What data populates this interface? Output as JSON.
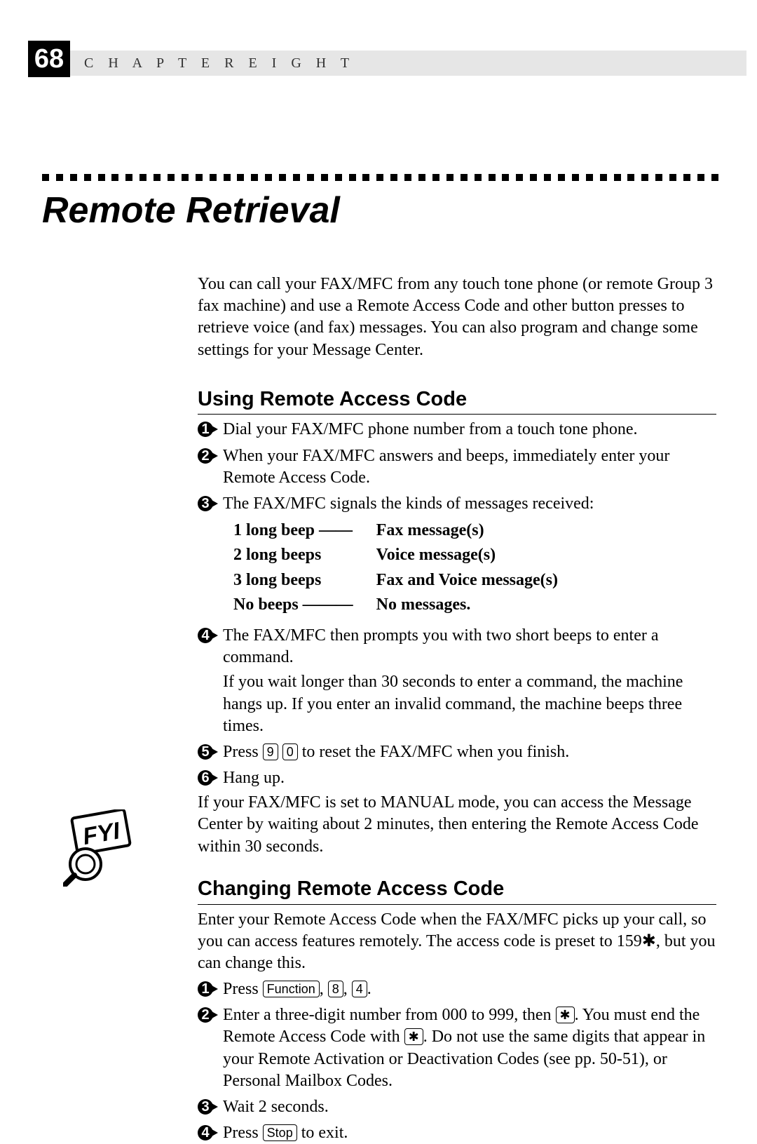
{
  "page": {
    "number": "68",
    "chapterLabel": "C H A P T E R   E I G H T"
  },
  "title": "Remote Retrieval",
  "intro": "You can call your FAX/MFC from any touch tone phone (or remote Group 3 fax machine) and use a Remote Access Code and other button presses to retrieve voice (and fax) messages.  You can also program and change some settings for your Message Center.",
  "section1": {
    "title": "Using Remote Access Code",
    "steps": [
      "Dial your FAX/MFC phone number from a touch tone phone.",
      "When your FAX/MFC answers and beeps, immediately enter your Remote Access Code.",
      "The FAX/MFC signals the kinds of messages received:"
    ],
    "signals": [
      [
        "1 long beep",
        "Fax message(s)"
      ],
      [
        "2 long beeps",
        "Voice message(s)"
      ],
      [
        "3 long beeps",
        "Fax and Voice message(s)"
      ],
      [
        "No beeps",
        "No messages."
      ]
    ],
    "step4a": "The FAX/MFC then prompts you with two short beeps to enter a command.",
    "step4b": "If you wait longer than 30 seconds to enter a command, the machine hangs up.  If you enter an invalid command, the machine beeps three times.",
    "step5_pre": "Press ",
    "step5_k1": "9",
    "step5_k2": "0",
    "step5_post": " to reset the FAX/MFC when you finish.",
    "step6": "Hang up.",
    "note": "If your FAX/MFC is set to MANUAL mode, you can access the Message Center by waiting about 2 minutes, then entering the Remote Access Code within 30 seconds."
  },
  "section2": {
    "title": "Changing Remote Access Code",
    "intro_pre": "Enter your Remote Access Code when the FAX/MFC picks up your call, so you can access features remotely.  The access code is preset to 159",
    "intro_star": "✱",
    "intro_post": ", but you can change this.",
    "step1_pre": "Press ",
    "step1_k1": "Function",
    "step1_mid1": ", ",
    "step1_k2": "8",
    "step1_mid2": ", ",
    "step1_k3": "4",
    "step1_post": ".",
    "step2_pre": "Enter a three-digit number from 000 to 999, then ",
    "step2_k": "✱",
    "step2_mid": ".  You must end the Remote Access Code with ",
    "step2_k2": "✱",
    "step2_post": ".  Do not use the same digits that appear in your Remote Activation or Deactivation Codes (see pp. 50-51), or Personal Mailbox Codes.",
    "step3": "Wait 2 seconds.",
    "step4_pre": "Press ",
    "step4_k": "Stop",
    "step4_post": " to exit."
  },
  "fyiLabel": "FYI"
}
